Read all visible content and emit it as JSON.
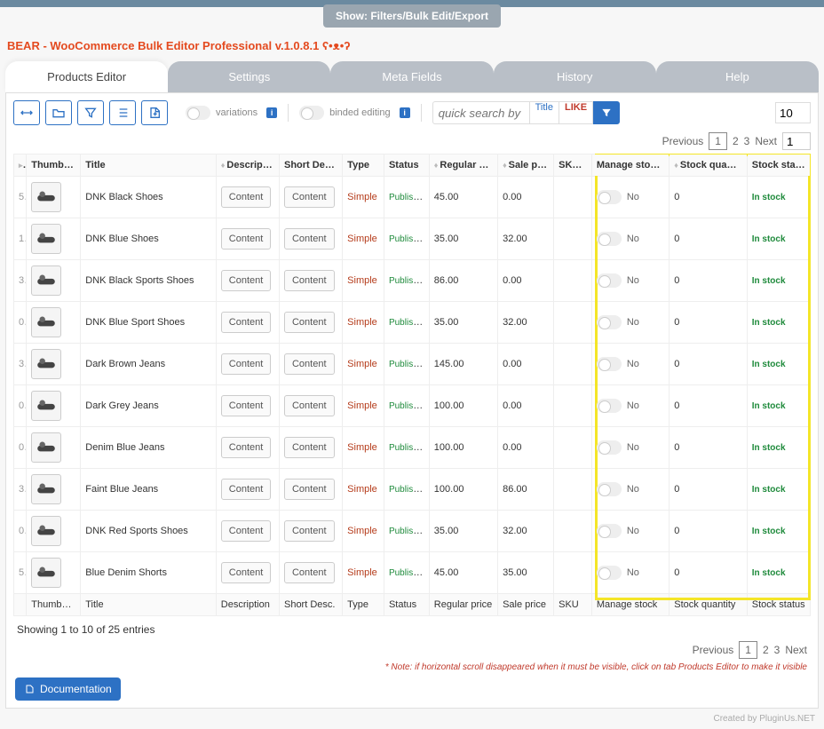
{
  "show_pill": "Show: Filters/Bulk Edit/Export",
  "app_title": "BEAR - WooCommerce Bulk Editor Professional v.1.0.8.1 ",
  "app_title_glyphs": "ʕ•ᴥ•ʔ",
  "tabs": {
    "products": "Products Editor",
    "settings": "Settings",
    "meta": "Meta Fields",
    "history": "History",
    "help": "Help"
  },
  "toolbar": {
    "variations_label": "variations",
    "binded_label": "binded editing",
    "search_placeholder": "quick search by ...",
    "search_column": "Title",
    "search_mode": "LIKE",
    "rows_per_page": "10"
  },
  "pager": {
    "previous": "Previous",
    "next": "Next",
    "pages": [
      "1",
      "2",
      "3"
    ],
    "current_input": "1"
  },
  "columns": {
    "thumbnail": "Thumbnail",
    "title": "Title",
    "description": "Description",
    "short_desc": "Short Desc.",
    "type": "Type",
    "status": "Status",
    "regular_price": "Regular price",
    "sale_price": "Sale price",
    "sku": "SKU",
    "manage_stock": "Manage stock",
    "stock_qty": "Stock quantity",
    "stock_status": "Stock status"
  },
  "content_btn": "Content",
  "toggle_no": "No",
  "stock_status_val": "In stock",
  "rows": [
    {
      "id": "5",
      "title": "DNK Black Shoes",
      "type": "Simple",
      "status": "Published",
      "rprice": "45.00",
      "sprice": "0.00",
      "sku": "",
      "qty": "0"
    },
    {
      "id": "1",
      "title": "DNK Blue Shoes",
      "type": "Simple",
      "status": "Published",
      "rprice": "35.00",
      "sprice": "32.00",
      "sku": "",
      "qty": "0"
    },
    {
      "id": "3",
      "title": "DNK Black Sports Shoes",
      "type": "Simple",
      "status": "Published",
      "rprice": "86.00",
      "sprice": "0.00",
      "sku": "",
      "qty": "0"
    },
    {
      "id": "0",
      "title": "DNK Blue Sport Shoes",
      "type": "Simple",
      "status": "Published",
      "rprice": "35.00",
      "sprice": "32.00",
      "sku": "",
      "qty": "0"
    },
    {
      "id": "3",
      "title": "Dark Brown Jeans",
      "type": "Simple",
      "status": "Published",
      "rprice": "145.00",
      "sprice": "0.00",
      "sku": "",
      "qty": "0"
    },
    {
      "id": "0",
      "title": "Dark Grey Jeans",
      "type": "Simple",
      "status": "Published",
      "rprice": "100.00",
      "sprice": "0.00",
      "sku": "",
      "qty": "0"
    },
    {
      "id": "0",
      "title": "Denim Blue Jeans",
      "type": "Simple",
      "status": "Published",
      "rprice": "100.00",
      "sprice": "0.00",
      "sku": "",
      "qty": "0"
    },
    {
      "id": "3",
      "title": "Faint Blue Jeans",
      "type": "Simple",
      "status": "Published",
      "rprice": "100.00",
      "sprice": "86.00",
      "sku": "",
      "qty": "0"
    },
    {
      "id": "0",
      "title": "DNK Red Sports Shoes",
      "type": "Simple",
      "status": "Published",
      "rprice": "35.00",
      "sprice": "32.00",
      "sku": "",
      "qty": "0"
    },
    {
      "id": "5",
      "title": "Blue Denim Shorts",
      "type": "Simple",
      "status": "Published",
      "rprice": "45.00",
      "sprice": "35.00",
      "sku": "",
      "qty": "0"
    }
  ],
  "entries_text": "Showing 1 to 10 of 25 entries",
  "note_text": "* Note: if horizontal scroll disappeared when it must be visible, click on tab Products Editor to make it visible",
  "doc_btn": "Documentation",
  "footer_credit": "Created by PluginUs.NET"
}
